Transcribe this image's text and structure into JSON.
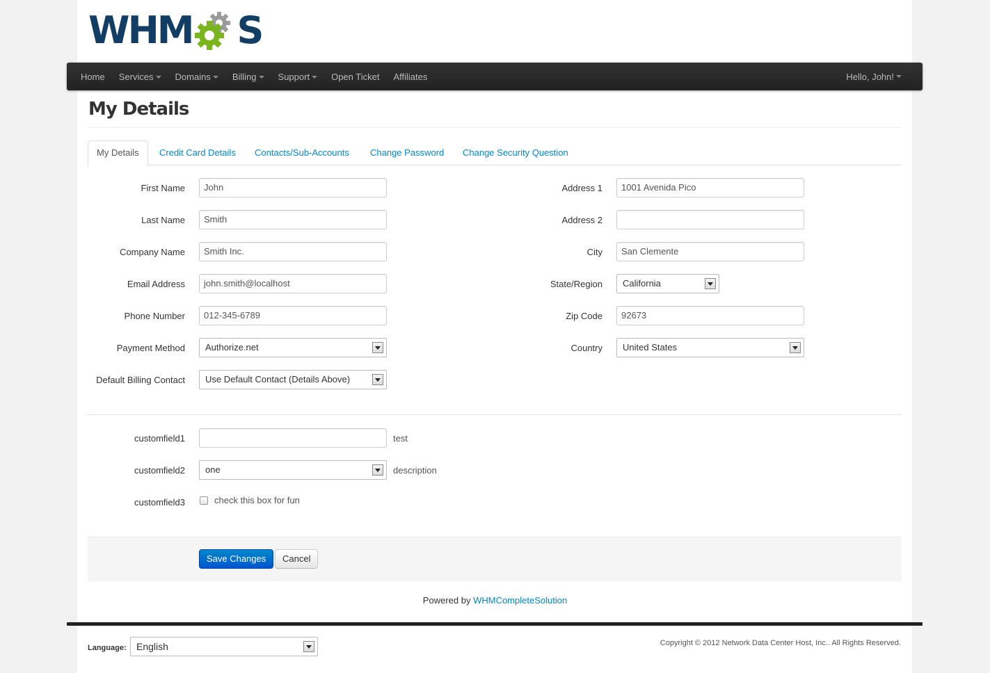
{
  "brand": {
    "logo_text_left": "WHM",
    "logo_text_right": "S",
    "gear_dark": "#9a9a9a",
    "gear_green": "#7ab51d",
    "navy": "#123e66"
  },
  "nav": {
    "items": [
      {
        "label": "Home",
        "dropdown": false
      },
      {
        "label": "Services",
        "dropdown": true
      },
      {
        "label": "Domains",
        "dropdown": true
      },
      {
        "label": "Billing",
        "dropdown": true
      },
      {
        "label": "Support",
        "dropdown": true
      },
      {
        "label": "Open Ticket",
        "dropdown": false
      },
      {
        "label": "Affiliates",
        "dropdown": false
      }
    ],
    "user": "Hello, John!"
  },
  "page_title": "My Details",
  "tabs": [
    {
      "label": "My Details",
      "active": true
    },
    {
      "label": "Credit Card Details",
      "active": false
    },
    {
      "label": "Contacts/Sub-Accounts",
      "active": false
    },
    {
      "label": "Change Password",
      "active": false
    },
    {
      "label": "Change Security Question",
      "active": false
    }
  ],
  "form": {
    "first_name": {
      "label": "First Name",
      "value": "John"
    },
    "last_name": {
      "label": "Last Name",
      "value": "Smith"
    },
    "company_name": {
      "label": "Company Name",
      "value": "Smith Inc."
    },
    "email": {
      "label": "Email Address",
      "value": "john.smith@localhost"
    },
    "phone": {
      "label": "Phone Number",
      "value": "012-345-6789"
    },
    "payment_method": {
      "label": "Payment Method",
      "value": "Authorize.net"
    },
    "billing_contact": {
      "label": "Default Billing Contact",
      "value": "Use Default Contact (Details Above)"
    },
    "address1": {
      "label": "Address 1",
      "value": "1001 Avenida Pico"
    },
    "address2": {
      "label": "Address 2",
      "value": ""
    },
    "city": {
      "label": "City",
      "value": "San Clemente"
    },
    "state": {
      "label": "State/Region",
      "value": "California"
    },
    "zip": {
      "label": "Zip Code",
      "value": "92673"
    },
    "country": {
      "label": "Country",
      "value": "United States"
    }
  },
  "custom_fields": {
    "cf1": {
      "label": "customfield1",
      "value": "",
      "help": "test"
    },
    "cf2": {
      "label": "customfield2",
      "value": "one",
      "help": "description"
    },
    "cf3": {
      "label": "customfield3",
      "checkbox_label": "check this box for fun",
      "checked": false
    }
  },
  "actions": {
    "save": "Save Changes",
    "cancel": "Cancel"
  },
  "footer": {
    "powered_prefix": "Powered by",
    "powered_link": "WHMCompleteSolution",
    "language_label": "Language:",
    "language_value": "English",
    "copyright": "Copyright © 2012 Network Data Center Host, Inc.. All Rights Reserved."
  }
}
